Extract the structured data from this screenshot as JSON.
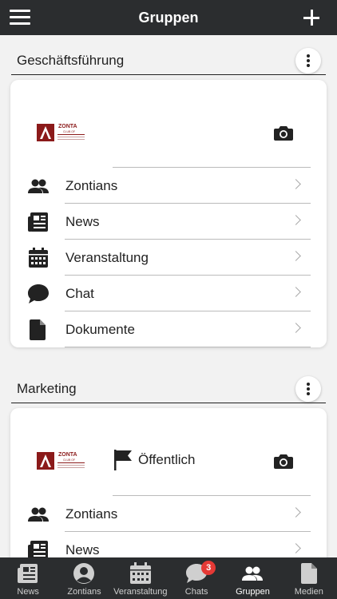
{
  "header": {
    "title": "Gruppen"
  },
  "groups": [
    {
      "name": "Geschäftsführung",
      "visibility": "",
      "logo": {
        "line1": "ZONTA",
        "line2": "CLUB OF"
      },
      "rows": [
        {
          "label": "Zontians",
          "icon": "people-icon"
        },
        {
          "label": "News",
          "icon": "news-icon"
        },
        {
          "label": "Veranstaltung",
          "icon": "calendar-icon"
        },
        {
          "label": "Chat",
          "icon": "chat-icon"
        },
        {
          "label": "Dokumente",
          "icon": "document-icon"
        }
      ]
    },
    {
      "name": "Marketing",
      "visibility": "Öffentlich",
      "logo": {
        "line1": "ZONTA",
        "line2": "CLUB OF"
      },
      "rows": [
        {
          "label": "Zontians",
          "icon": "people-icon"
        },
        {
          "label": "News",
          "icon": "news-icon"
        }
      ]
    }
  ],
  "tabs": [
    {
      "label": "News",
      "icon": "news-icon"
    },
    {
      "label": "Zontians",
      "icon": "person-icon"
    },
    {
      "label": "Veranstaltung",
      "icon": "calendar-icon"
    },
    {
      "label": "Chats",
      "icon": "chat-icon",
      "badge": "3"
    },
    {
      "label": "Gruppen",
      "icon": "people-icon",
      "active": true
    },
    {
      "label": "Medien",
      "icon": "document-icon"
    }
  ],
  "colors": {
    "bar": "#2b2d2f",
    "badge": "#e53935",
    "logo": "#8b1a1a"
  }
}
